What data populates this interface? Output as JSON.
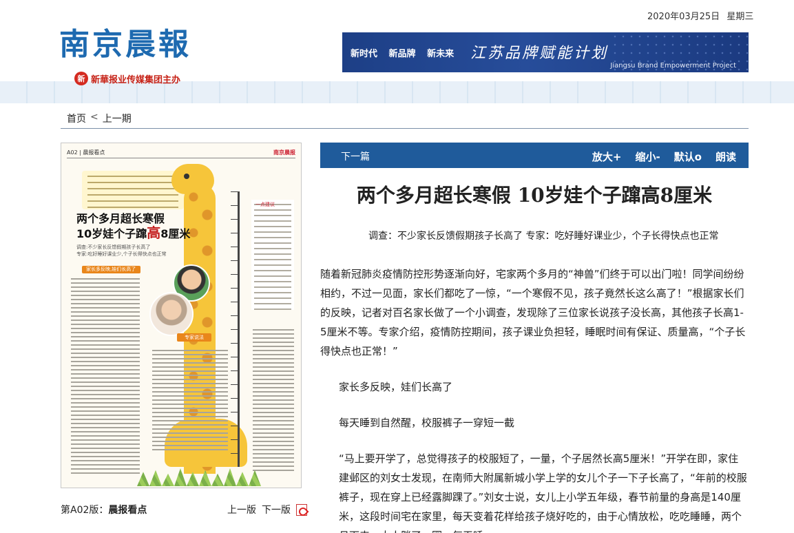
{
  "header": {
    "masthead": "南京晨報",
    "sponsor_logo": "新",
    "sponsor_text": "新華报业传媒集团主办",
    "date": "2020年03月25日",
    "weekday": "星期三",
    "banner": {
      "slogans": [
        "新时代",
        "新品牌",
        "新未来"
      ],
      "title": "江苏品牌赋能计划",
      "subtitle": "Jiangsu Brand Empowerment Project"
    }
  },
  "breadcrumb": {
    "home": "首页",
    "separator": "<",
    "prev": "上一期"
  },
  "page_image": {
    "section": "A02 | 晨报看点",
    "paper_name": "南京晨报",
    "title_line1": "两个多月超长寒假",
    "title_line2_a": "10岁娃个子蹿",
    "title_line2_b": "高",
    "title_line2_c": "8厘米",
    "sub1": "调查:不少家长反馈假期孩子长高了",
    "sub2": "专家:吃好睡好课业少,个子长得快点也正常",
    "tag": "家长多反映,娃们长高了",
    "expert": "专家说法",
    "side_label": "一点建议"
  },
  "page_footer": {
    "page_label": "第A02版：",
    "page_name": "晨报看点",
    "prev_page": "上一版",
    "next_page": "下一版"
  },
  "toolbar": {
    "next": "下一篇",
    "zoom_in": "放大+",
    "zoom_out": "缩小-",
    "default": "默认o",
    "read": "朗读"
  },
  "article": {
    "title": "两个多月超长寒假 10岁娃个子蹿高8厘米",
    "subtitle": "调查：不少家长反馈假期孩子长高了 专家：吃好睡好课业少，个子长得快点也正常",
    "para1": "随着新冠肺炎疫情防控形势逐渐向好，宅家两个多月的“神兽”们终于可以出门啦！同学间纷纷相约，不过一见面，家长们都吃了一惊，“一个寒假不见，孩子竟然长这么高了！”根据家长们的反映，记者对百名家长做了一个小调查，发现除了三位家长说孩子没长高，其他孩子长高1-5厘米不等。专家介绍，疫情防控期间，孩子课业负担轻，睡眠时间有保证、质量高，“个子长得快点也正常！”",
    "para2": "家长多反映，娃们长高了",
    "para3": "每天睡到自然醒，校服裤子一穿短一截",
    "para4": "“马上要开学了，总觉得孩子的校服短了，一量，个子居然长高5厘米！”开学在即，家住建邺区的刘女士发现，在南师大附属新城小学上学的女儿个子一下子长高了，“年前的校服裤子，现在穿上已经露脚踝了。”刘女士说，女儿上小学五年级，春节前量的身高是140厘米，这段时间宅在家里，每天变着花样给孩子烧好吃的，由于心情放松，吃吃睡睡，两个月下来，大人胖了一圈，每天睡"
  }
}
